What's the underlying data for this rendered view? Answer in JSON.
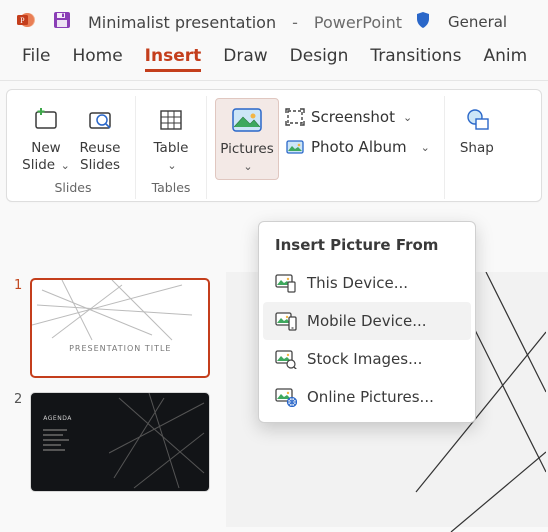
{
  "title_bar": {
    "doc_name": "Minimalist presentation",
    "separator": "-",
    "app_name": "PowerPoint",
    "sensitivity": "General"
  },
  "tabs": {
    "file": "File",
    "home": "Home",
    "insert": "Insert",
    "draw": "Draw",
    "design": "Design",
    "transitions": "Transitions",
    "animations": "Anim",
    "active": "insert"
  },
  "ribbon": {
    "new_slide": "New Slide",
    "reuse_slides": "Reuse Slides",
    "group_slides": "Slides",
    "table": "Table",
    "group_tables": "Tables",
    "pictures": "Pictures",
    "screenshot": "Screenshot",
    "photo_album": "Photo Album",
    "shapes": "Shap"
  },
  "dropdown": {
    "header": "Insert Picture From",
    "this_device": "This Device...",
    "mobile_device": "Mobile Device...",
    "stock_images": "Stock Images...",
    "online_pictures": "Online Pictures..."
  },
  "slides": {
    "num1": "1",
    "num2": "2",
    "slide1_title": "PRESENTATION TITLE",
    "slide2_title": "AGENDA"
  }
}
